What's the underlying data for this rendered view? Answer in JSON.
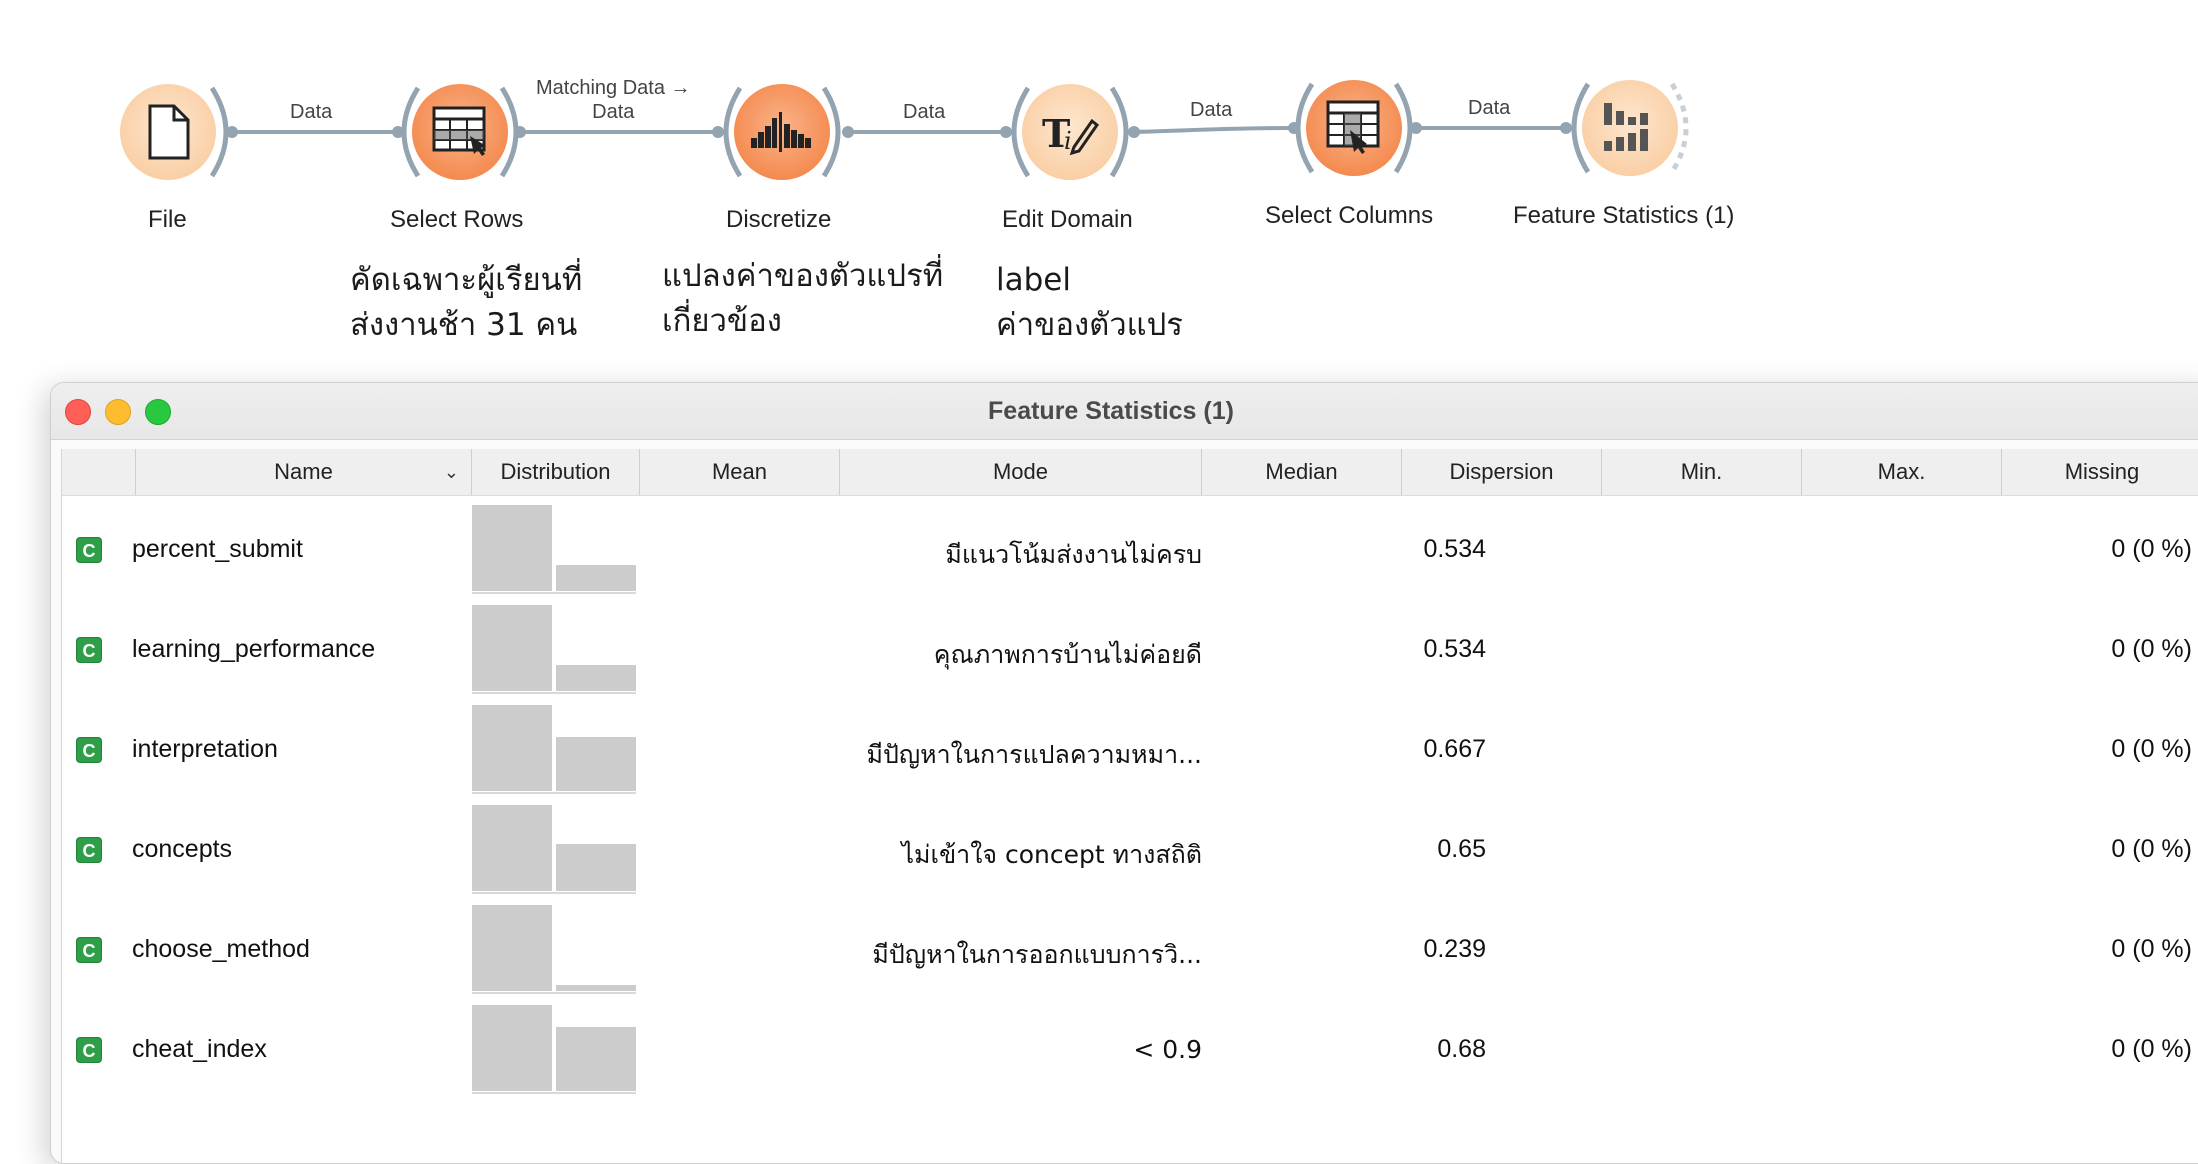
{
  "workflow": {
    "nodes": [
      {
        "label": "File",
        "icon": "file-icon"
      },
      {
        "label": "Select Rows",
        "icon": "select-rows-icon"
      },
      {
        "label": "Discretize",
        "icon": "discretize-icon"
      },
      {
        "label": "Edit Domain",
        "icon": "edit-domain-icon"
      },
      {
        "label": "Select Columns",
        "icon": "select-columns-icon"
      },
      {
        "label": "Feature Statistics (1)",
        "icon": "feature-statistics-icon"
      }
    ],
    "links": [
      {
        "label": "Data"
      },
      {
        "label_line1": "Matching Data →",
        "label_line2": "Data"
      },
      {
        "label": "Data"
      },
      {
        "label": "Data"
      },
      {
        "label": "Data"
      }
    ],
    "annotations": [
      {
        "line1": "คัดเฉพาะผู้เรียนที่",
        "line2": "ส่งงานช้า 31 คน"
      },
      {
        "line1": "แปลงค่าของตัวแปรที่",
        "line2": "เกี่ยวข้อง"
      },
      {
        "line1": "label",
        "line2": "ค่าของตัวแปร"
      }
    ]
  },
  "window": {
    "title": "Feature Statistics (1)",
    "columns": [
      "Name",
      "Distribution",
      "Mean",
      "Mode",
      "Median",
      "Dispersion",
      "Min.",
      "Max.",
      "Missing"
    ],
    "rows": [
      {
        "type": "C",
        "name": "percent_submit",
        "mode": "มีแนวโน้มส่งงานไม่ครบ",
        "dispersion": "0.534",
        "missing": "0 (0 %)",
        "dist": [
          1.0,
          0.3
        ]
      },
      {
        "type": "C",
        "name": "learning_performance",
        "mode": "คุณภาพการบ้านไม่ค่อยดี",
        "dispersion": "0.534",
        "missing": "0 (0 %)",
        "dist": [
          1.0,
          0.3
        ]
      },
      {
        "type": "C",
        "name": "interpretation",
        "mode": "มีปัญหาในการแปลความหมา...",
        "dispersion": "0.667",
        "missing": "0 (0 %)",
        "dist": [
          1.0,
          0.63
        ]
      },
      {
        "type": "C",
        "name": "concepts",
        "mode": "ไม่เข้าใจ concept ทางสถิติ",
        "dispersion": "0.65",
        "missing": "0 (0 %)",
        "dist": [
          1.0,
          0.55
        ]
      },
      {
        "type": "C",
        "name": "choose_method",
        "mode": "มีปัญหาในการออกแบบการวิ...",
        "dispersion": "0.239",
        "missing": "0 (0 %)",
        "dist": [
          1.0,
          0.07
        ]
      },
      {
        "type": "C",
        "name": "cheat_index",
        "mode": "< 0.9",
        "dispersion": "0.68",
        "missing": "0 (0 %)",
        "dist": [
          1.0,
          0.74
        ]
      }
    ]
  },
  "colors": {
    "node_light": "#fad0a7",
    "node_dark": "#f58f56",
    "link": "#93a3b0",
    "badge": "#2e9e48",
    "bar": "#cccccc"
  }
}
